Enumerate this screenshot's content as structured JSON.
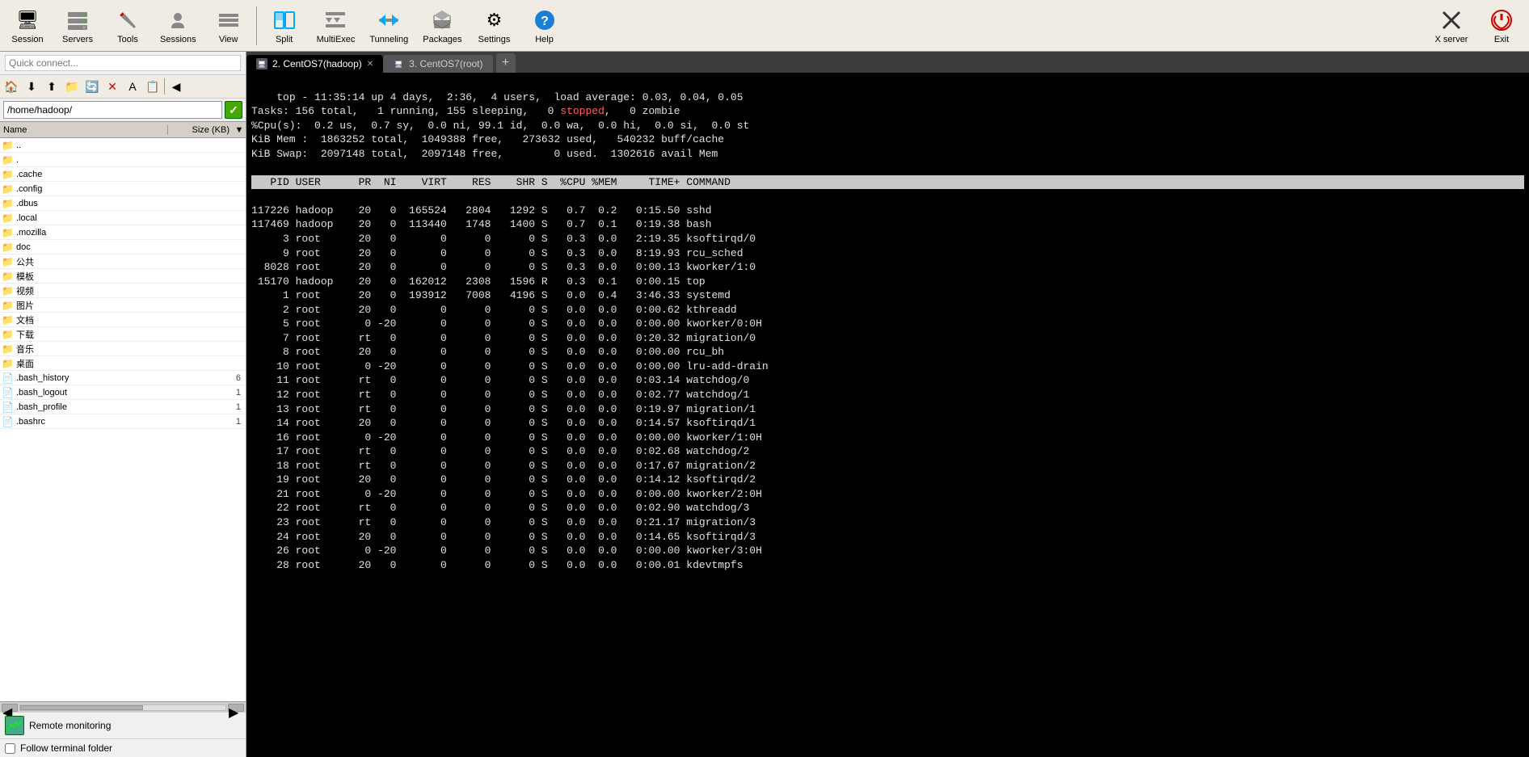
{
  "toolbar": {
    "items": [
      {
        "id": "session",
        "label": "Session",
        "icon": "🖥"
      },
      {
        "id": "servers",
        "label": "Servers",
        "icon": "🖧"
      },
      {
        "id": "tools",
        "label": "Tools",
        "icon": "🔧"
      },
      {
        "id": "sessions",
        "label": "Sessions",
        "icon": "👤"
      },
      {
        "id": "view",
        "label": "View",
        "icon": "👁"
      },
      {
        "id": "split",
        "label": "Split",
        "icon": "⊞"
      },
      {
        "id": "multiexec",
        "label": "MultiExec",
        "icon": "▶▶"
      },
      {
        "id": "tunneling",
        "label": "Tunneling",
        "icon": "⇄"
      },
      {
        "id": "packages",
        "label": "Packages",
        "icon": "📦"
      },
      {
        "id": "settings",
        "label": "Settings",
        "icon": "⚙"
      },
      {
        "id": "help",
        "label": "Help",
        "icon": "?"
      },
      {
        "id": "xserver",
        "label": "X server",
        "icon": "✕"
      },
      {
        "id": "exit",
        "label": "Exit",
        "icon": "⏻"
      }
    ]
  },
  "sidebar": {
    "quick_connect_placeholder": "Quick connect...",
    "address_bar_value": "/home/hadoop/",
    "file_list_headers": [
      "Name",
      "Size (KB)"
    ],
    "files": [
      {
        "name": "..",
        "size": "",
        "icon": "📁"
      },
      {
        "name": ".",
        "size": "",
        "icon": "📁"
      },
      {
        "name": ".cache",
        "size": "",
        "icon": "📁"
      },
      {
        "name": ".config",
        "size": "",
        "icon": "📁"
      },
      {
        "name": ".dbus",
        "size": "",
        "icon": "📁"
      },
      {
        "name": ".local",
        "size": "",
        "icon": "📁"
      },
      {
        "name": ".mozilla",
        "size": "",
        "icon": "📁"
      },
      {
        "name": "doc",
        "size": "",
        "icon": "📁"
      },
      {
        "name": "公共",
        "size": "",
        "icon": "📁"
      },
      {
        "name": "模板",
        "size": "",
        "icon": "📁"
      },
      {
        "name": "视频",
        "size": "",
        "icon": "📁"
      },
      {
        "name": "图片",
        "size": "",
        "icon": "📁"
      },
      {
        "name": "文档",
        "size": "",
        "icon": "📁"
      },
      {
        "name": "下载",
        "size": "",
        "icon": "📁"
      },
      {
        "name": "音乐",
        "size": "",
        "icon": "📁"
      },
      {
        "name": "桌面",
        "size": "",
        "icon": "📁"
      },
      {
        "name": ".bash_history",
        "size": "6",
        "icon": "📄"
      },
      {
        "name": ".bash_logout",
        "size": "1",
        "icon": "📄"
      },
      {
        "name": ".bash_profile",
        "size": "1",
        "icon": "📄"
      },
      {
        "name": ".bashrc",
        "size": "1",
        "icon": "📄"
      }
    ],
    "remote_monitoring_label": "Remote monitoring",
    "follow_terminal_label": "Follow terminal folder"
  },
  "tabs": [
    {
      "id": "tab1",
      "label": "2. CentOS7(hadoop)",
      "active": true
    },
    {
      "id": "tab2",
      "label": "3. CentOS7(root)",
      "active": false
    }
  ],
  "terminal": {
    "lines": [
      "top - 11:35:14 up 4 days,  2:36,  4 users,  load average: 0.03, 0.04, 0.05",
      "Tasks: 156 total,   1 running, 155 sleeping,   0 stopped,   0 zombie",
      "%Cpu(s):  0.2 us,  0.7 sy,  0.0 ni, 99.1 id,  0.0 wa,  0.0 hi,  0.0 si,  0.0 st",
      "KiB Mem :  1863252 total,  1049388 free,   273632 used,   540232 buff/cache",
      "KiB Swap:  2097148 total,  2097148 free,        0 used.  1302616 avail Mem",
      "",
      "   PID USER      PR  NI    VIRT    RES    SHR S  %CPU %MEM     TIME+ COMMAND",
      "117226 hadoop    20   0  165524   2804   1292 S   0.7  0.2   0:15.50 sshd",
      "117469 hadoop    20   0  113440   1748   1400 S   0.7  0.1   0:19.38 bash",
      "     3 root      20   0       0      0      0 S   0.3  0.0   2:19.35 ksoftirqd/0",
      "     9 root      20   0       0      0      0 S   0.3  0.0   8:19.93 rcu_sched",
      "  8028 root      20   0       0      0      0 S   0.3  0.0   0:00.13 kworker/1:0",
      " 15170 hadoop    20   0  162012   2308   1596 R   0.3  0.1   0:00.15 top",
      "     1 root      20   0  193912   7008   4196 S   0.0  0.4   3:46.33 systemd",
      "     2 root      20   0       0      0      0 S   0.0  0.0   0:00.62 kthreadd",
      "     5 root       0 -20       0      0      0 S   0.0  0.0   0:00.00 kworker/0:0H",
      "     7 root      rt   0       0      0      0 S   0.0  0.0   0:20.32 migration/0",
      "     8 root      20   0       0      0      0 S   0.0  0.0   0:00.00 rcu_bh",
      "    10 root       0 -20       0      0      0 S   0.0  0.0   0:00.00 lru-add-drain",
      "    11 root      rt   0       0      0      0 S   0.0  0.0   0:03.14 watchdog/0",
      "    12 root      rt   0       0      0      0 S   0.0  0.0   0:02.77 watchdog/1",
      "    13 root      rt   0       0      0      0 S   0.0  0.0   0:19.97 migration/1",
      "    14 root      20   0       0      0      0 S   0.0  0.0   0:14.57 ksoftirqd/1",
      "    16 root       0 -20       0      0      0 S   0.0  0.0   0:00.00 kworker/1:0H",
      "    17 root      rt   0       0      0      0 S   0.0  0.0   0:02.68 watchdog/2",
      "    18 root      rt   0       0      0      0 S   0.0  0.0   0:17.67 migration/2",
      "    19 root      20   0       0      0      0 S   0.0  0.0   0:14.12 ksoftirqd/2",
      "    21 root       0 -20       0      0      0 S   0.0  0.0   0:00.00 kworker/2:0H",
      "    22 root      rt   0       0      0      0 S   0.0  0.0   0:02.90 watchdog/3",
      "    23 root      rt   0       0      0      0 S   0.0  0.0   0:21.17 migration/3",
      "    24 root      20   0       0      0      0 S   0.0  0.0   0:14.65 ksoftirqd/3",
      "    26 root       0 -20       0      0      0 S   0.0  0.0   0:00.00 kworker/3:0H",
      "    28 root      20   0       0      0      0 S   0.0  0.0   0:00.01 kdevtmpfs"
    ]
  }
}
